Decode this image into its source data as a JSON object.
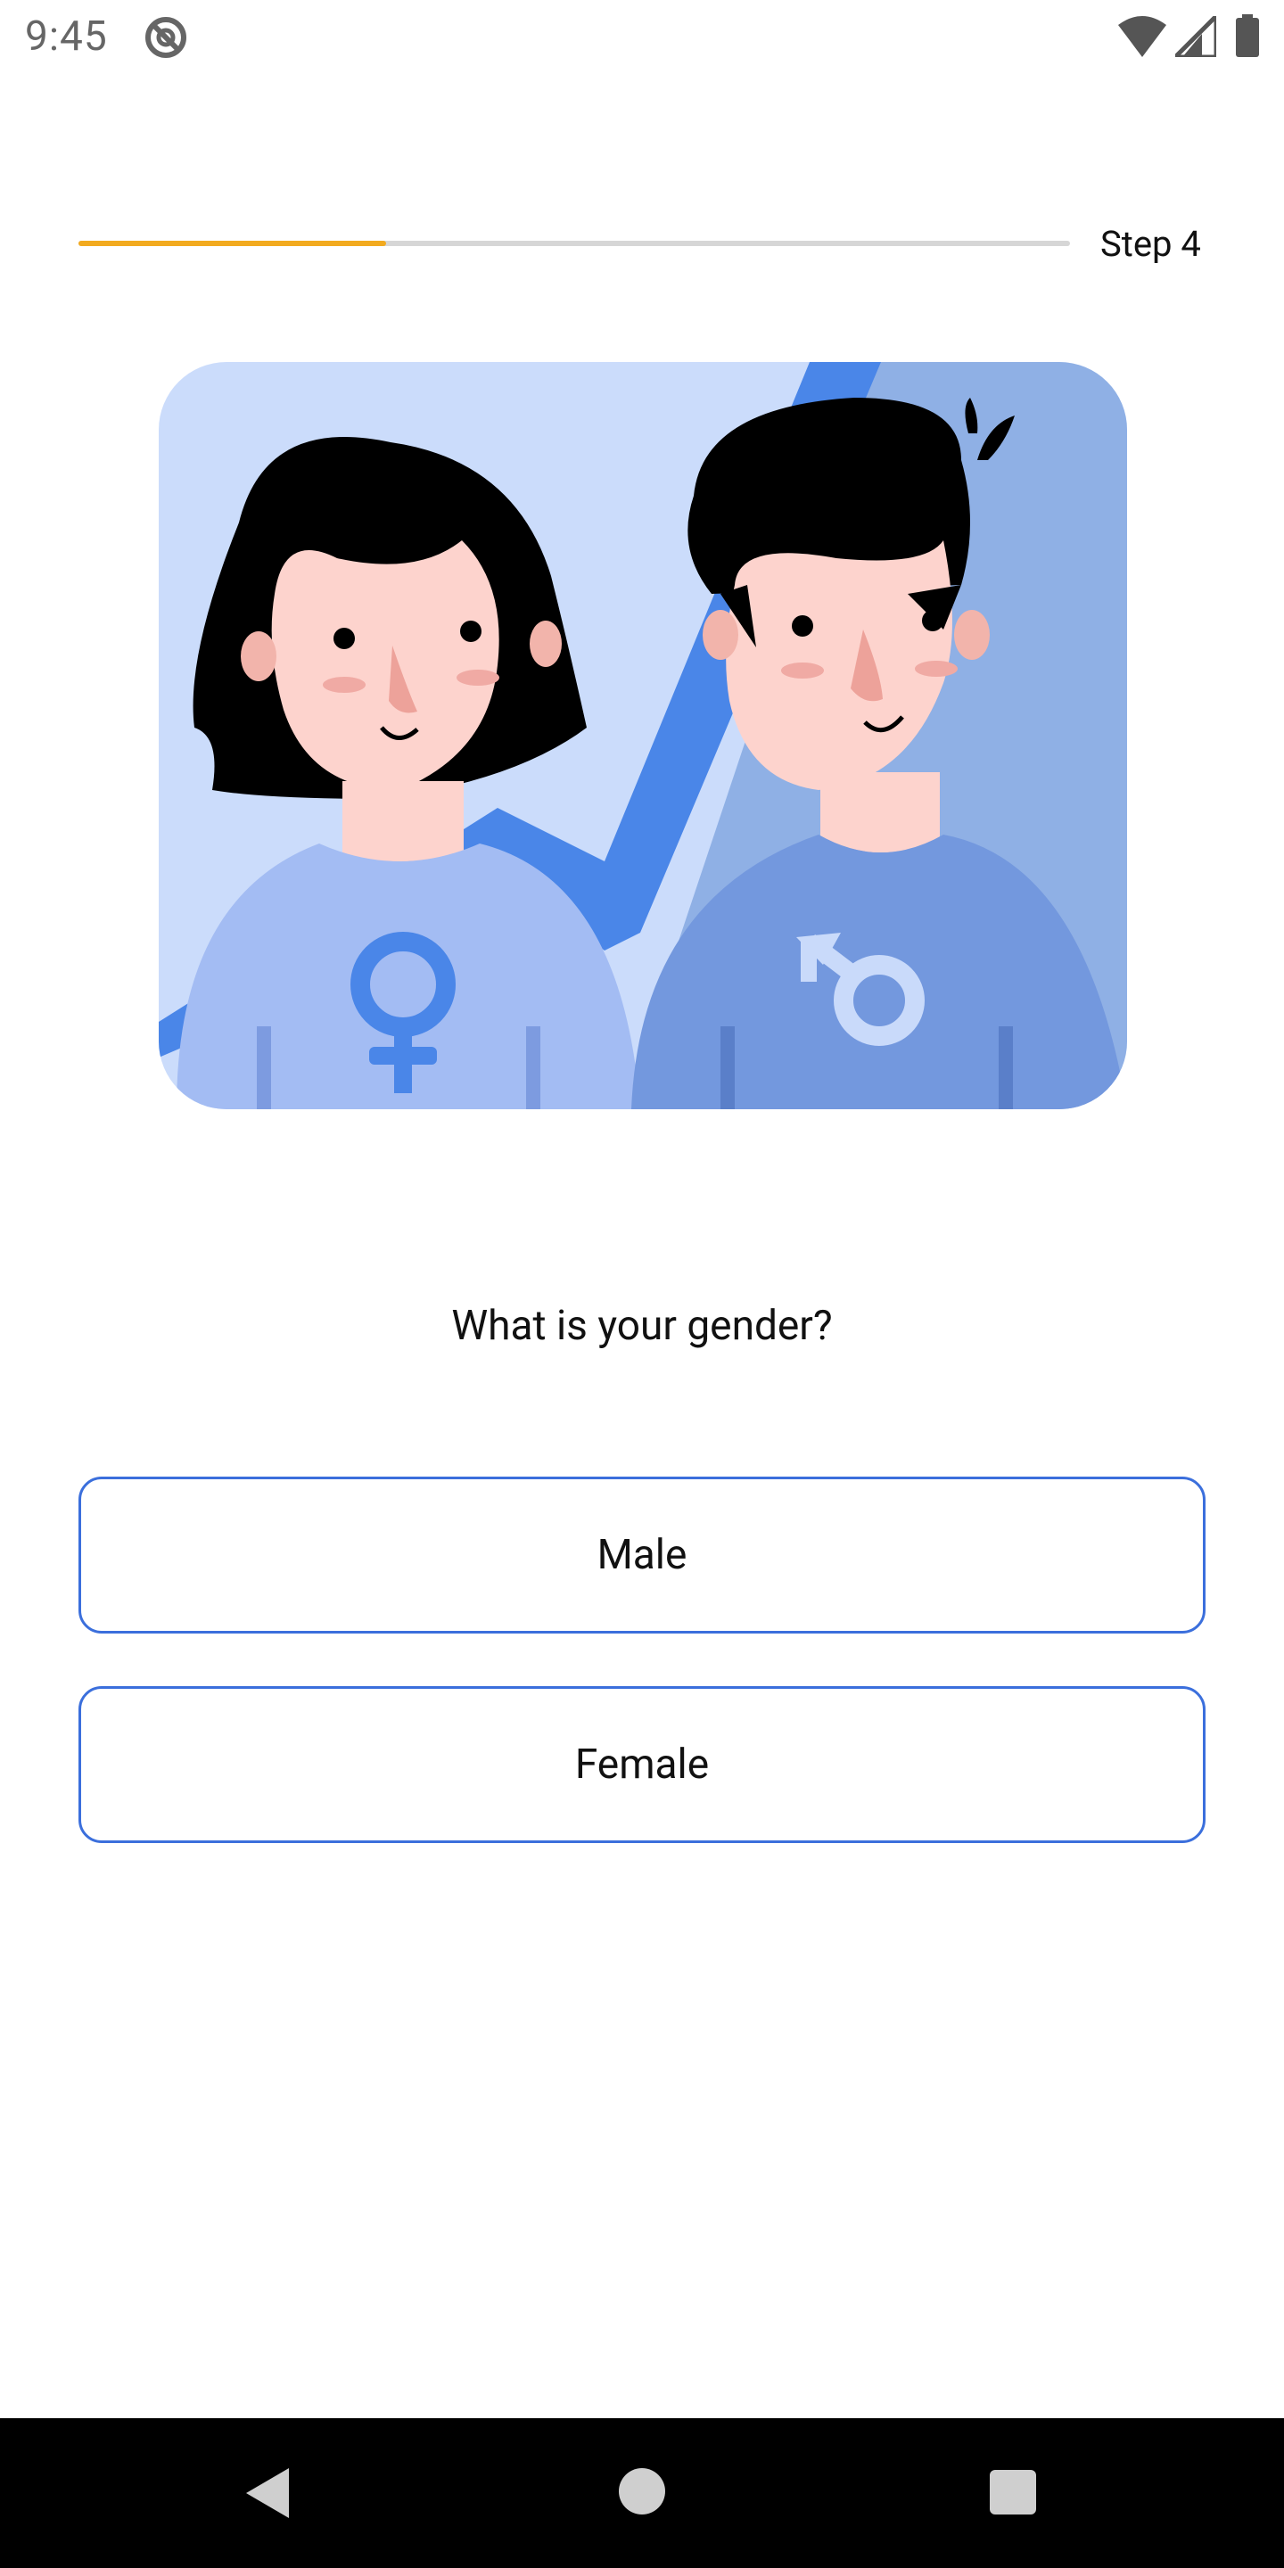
{
  "status_bar": {
    "time": "9:45",
    "icons": [
      "sync-disabled-icon",
      "wifi-icon",
      "signal-icon",
      "battery-icon"
    ]
  },
  "progress": {
    "step_label": "Step 4",
    "fraction": 0.31,
    "colors": {
      "fill": "#f2aa1f",
      "track": "#d6d6d6"
    }
  },
  "illustration": {
    "icons": [
      "female-symbol-icon",
      "male-symbol-icon"
    ]
  },
  "question": "What is your gender?",
  "options": [
    {
      "label": "Male"
    },
    {
      "label": "Female"
    }
  ],
  "accent_color": "#3b6fdc",
  "nav_bar": {
    "icons": [
      "back-icon",
      "home-icon",
      "recents-icon"
    ]
  }
}
